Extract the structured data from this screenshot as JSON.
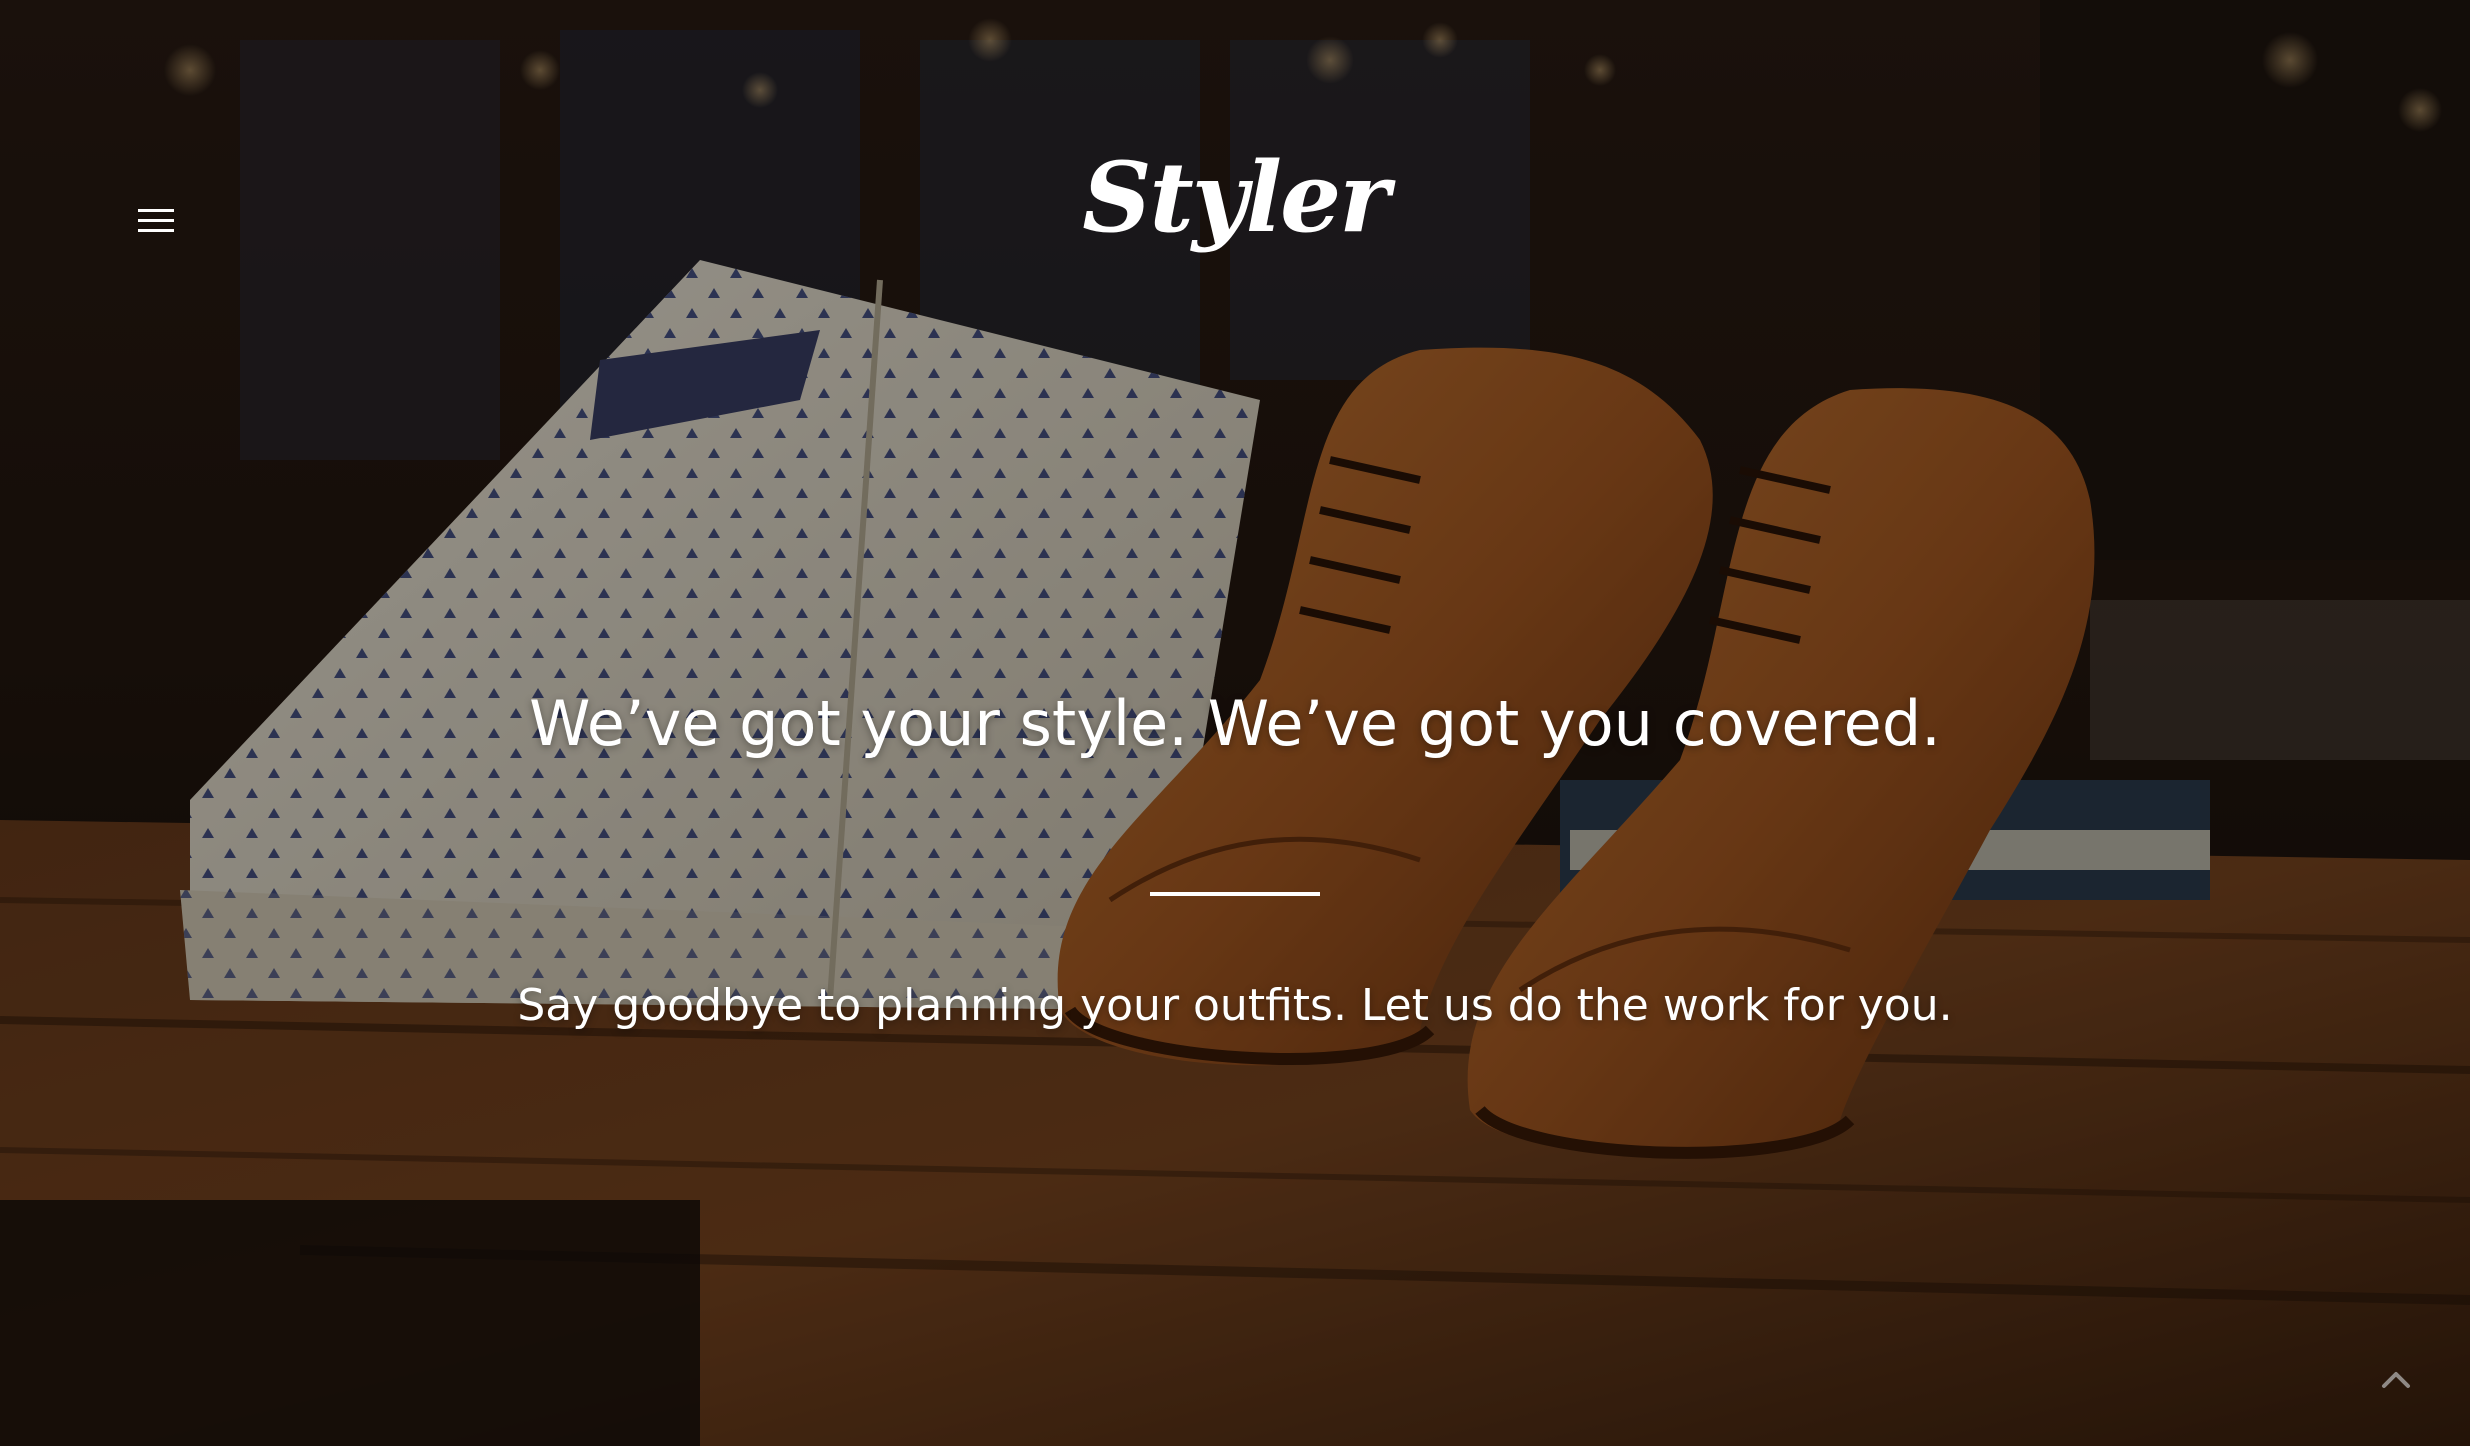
{
  "header": {
    "logo_text": "Styler",
    "menu_icon": "hamburger-menu-icon"
  },
  "hero": {
    "background_image": "folded patterned shirts and brown leather oxford shoes on a wooden table",
    "headline": "We’ve got your style. We’ve got you covered.",
    "subheadline": "Say goodbye to planning your outfits. Let us do the work for you."
  },
  "scroll_top": {
    "icon": "chevron-up-icon"
  },
  "colors": {
    "text": "#ffffff",
    "overlay": "#000000",
    "wood": "#5a3217",
    "leather": "#b8692a",
    "shirt": "#ece6d6",
    "pattern": "#2c3a78"
  }
}
